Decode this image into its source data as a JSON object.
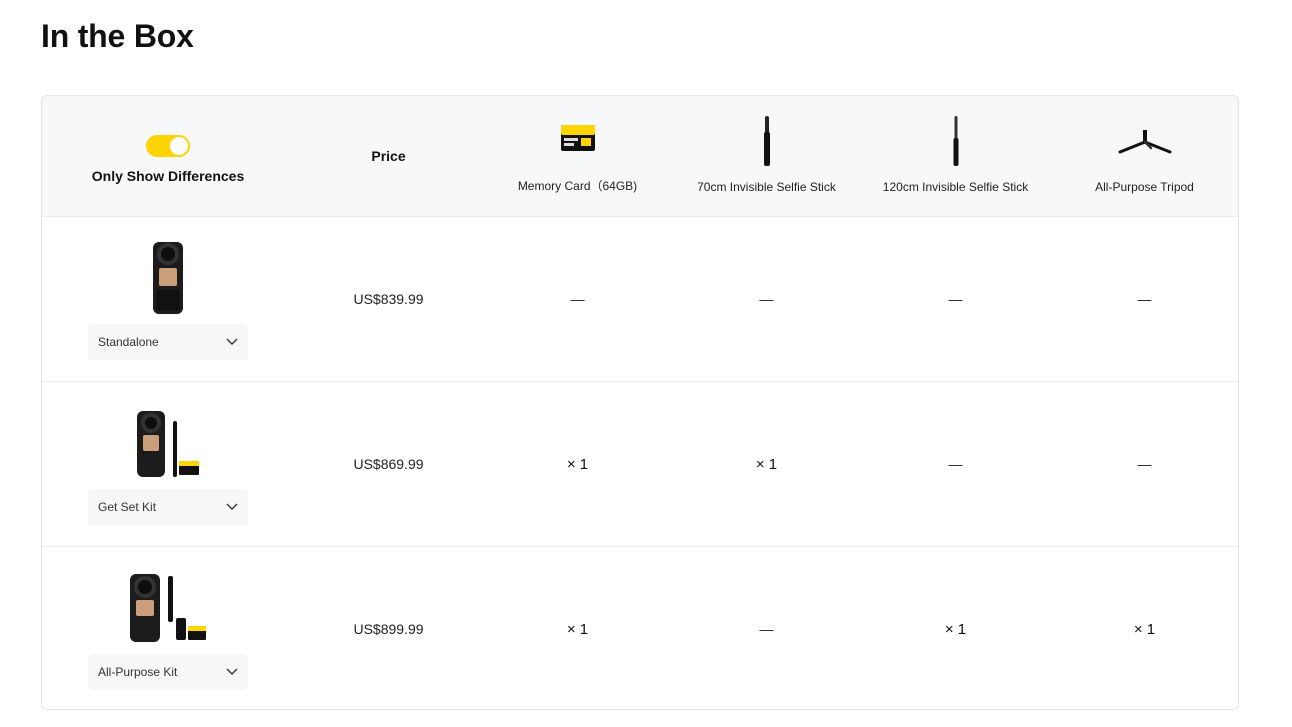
{
  "page": {
    "title": "In the Box"
  },
  "header": {
    "toggle_label": "Only Show Differences",
    "price_label": "Price",
    "products": [
      {
        "label": "Memory Card（64GB)",
        "icon": "memory-card-icon"
      },
      {
        "label": "70cm Invisible Selfie Stick",
        "icon": "selfie-stick-70-icon"
      },
      {
        "label": "120cm Invisible Selfie Stick",
        "icon": "selfie-stick-120-icon"
      },
      {
        "label": "All-Purpose Tripod",
        "icon": "tripod-icon"
      }
    ]
  },
  "rows": [
    {
      "bundle": "Standalone",
      "price": "US$839.99",
      "cells": [
        "—",
        "—",
        "—",
        "—"
      ]
    },
    {
      "bundle": "Get Set Kit",
      "price": "US$869.99",
      "cells": [
        "× 1",
        "× 1",
        "—",
        "—"
      ]
    },
    {
      "bundle": "All-Purpose Kit",
      "price": "US$899.99",
      "cells": [
        "× 1",
        "—",
        "× 1",
        "× 1"
      ]
    }
  ],
  "colors": {
    "accent": "#ffd400",
    "header_bg": "#f7f8fa",
    "select_bg": "#f7f7f8"
  }
}
